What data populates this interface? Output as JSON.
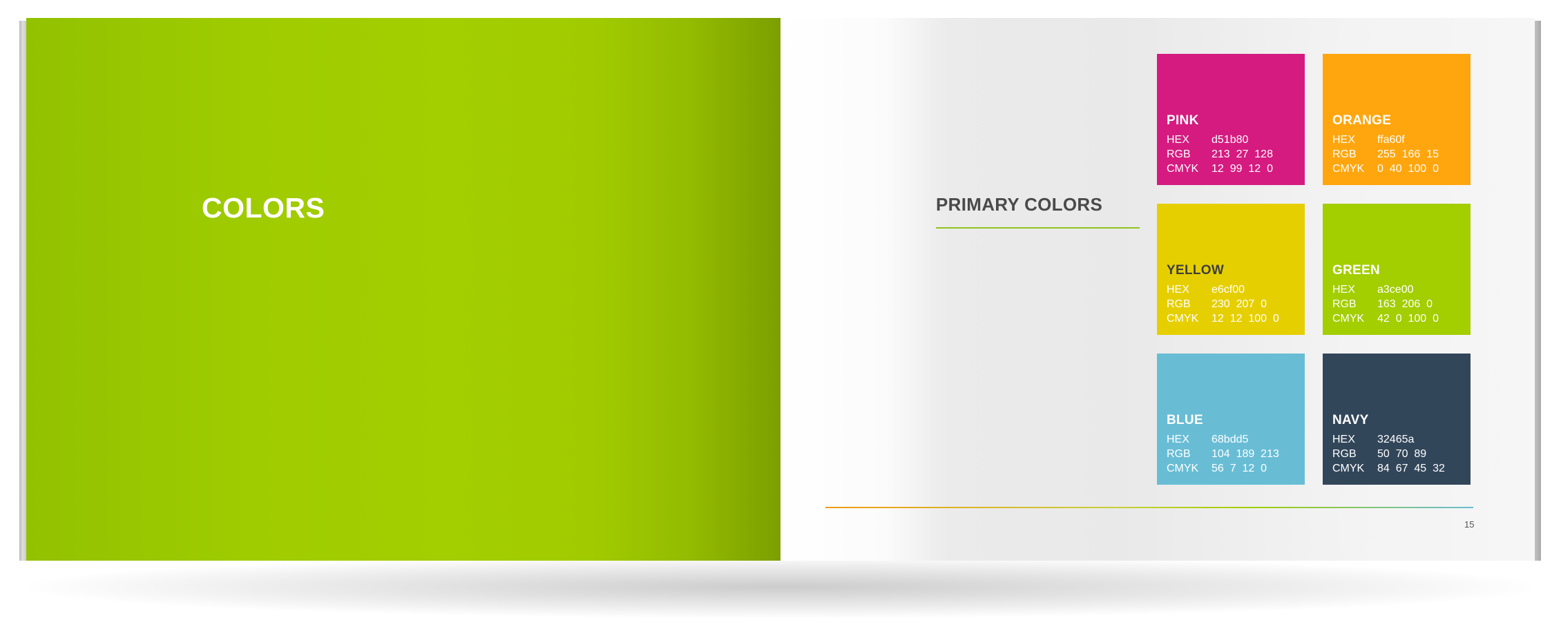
{
  "left_page": {
    "title": "COLORS"
  },
  "right_page": {
    "section_title": "PRIMARY COLORS",
    "page_number": "15",
    "swatches": [
      {
        "name": "PINK",
        "color": "#d51b80",
        "rows": [
          {
            "label": "HEX",
            "value": "d51b80"
          },
          {
            "label": "RGB",
            "value": "213  27  128"
          },
          {
            "label": "CMYK",
            "value": "12  99  12  0"
          }
        ]
      },
      {
        "name": "ORANGE",
        "color": "#ffa60f",
        "rows": [
          {
            "label": "HEX",
            "value": "ffa60f"
          },
          {
            "label": "RGB",
            "value": "255  166  15"
          },
          {
            "label": "CMYK",
            "value": "0  40  100  0"
          }
        ]
      },
      {
        "name": "YELLOW",
        "color": "#e6cf00",
        "rows": [
          {
            "label": "HEX",
            "value": "e6cf00"
          },
          {
            "label": "RGB",
            "value": "230  207  0"
          },
          {
            "label": "CMYK",
            "value": "12  12  100  0"
          }
        ]
      },
      {
        "name": "GREEN",
        "color": "#a3ce00",
        "rows": [
          {
            "label": "HEX",
            "value": "a3ce00"
          },
          {
            "label": "RGB",
            "value": "163  206  0"
          },
          {
            "label": "CMYK",
            "value": "42  0  100  0"
          }
        ]
      },
      {
        "name": "BLUE",
        "color": "#68bdd5",
        "rows": [
          {
            "label": "HEX",
            "value": "68bdd5"
          },
          {
            "label": "RGB",
            "value": "104  189  213"
          },
          {
            "label": "CMYK",
            "value": "56  7  12  0"
          }
        ]
      },
      {
        "name": "NAVY",
        "color": "#32465a",
        "rows": [
          {
            "label": "HEX",
            "value": "32465a"
          },
          {
            "label": "RGB",
            "value": "50  70  89"
          },
          {
            "label": "CMYK",
            "value": "84  67  45  32"
          }
        ]
      }
    ]
  }
}
